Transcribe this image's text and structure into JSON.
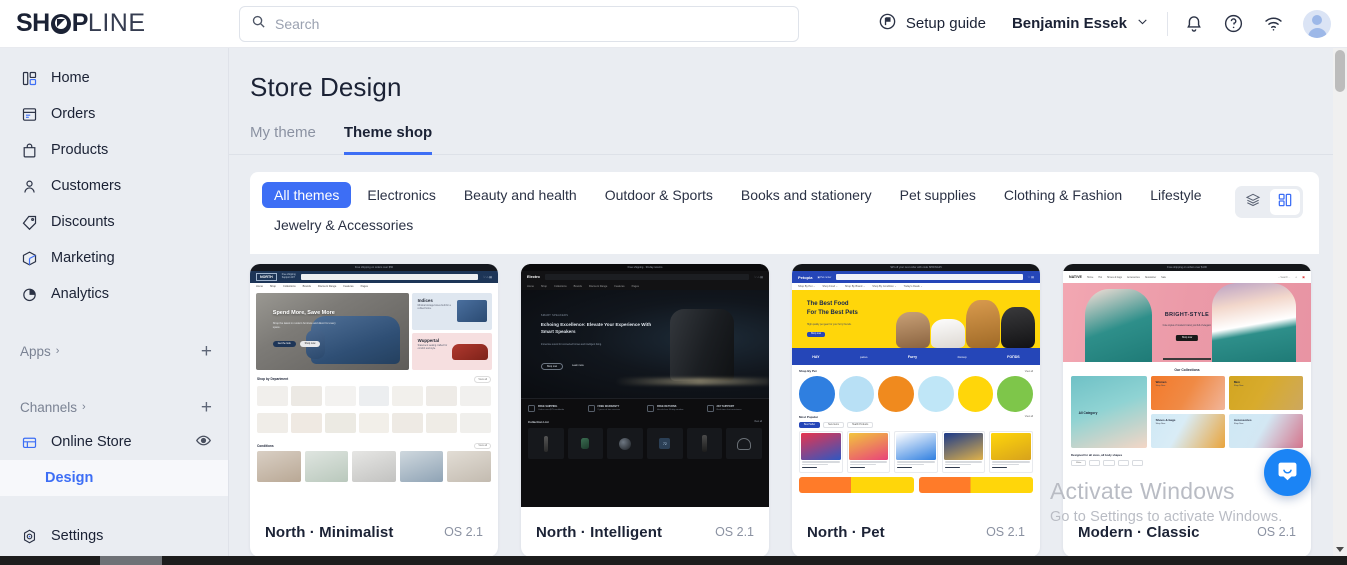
{
  "topbar": {
    "logo_bold": "SH",
    "logo_rest": "P",
    "logo_light": "LINE",
    "search_placeholder": "Search",
    "search_value": "",
    "setup_guide_label": "Setup guide",
    "user_name": "Benjamin Essek",
    "icons": {
      "search": "search-icon",
      "flag": "flag-icon",
      "chevron": "chevron-down-icon",
      "bell": "bell-icon",
      "help": "help-circle-icon",
      "wifi": "wifi-icon",
      "avatar": "avatar-icon"
    }
  },
  "sidebar": {
    "items": [
      {
        "label": "Home",
        "icon": "home-dashboard-icon"
      },
      {
        "label": "Orders",
        "icon": "orders-icon"
      },
      {
        "label": "Products",
        "icon": "products-bag-icon"
      },
      {
        "label": "Customers",
        "icon": "customers-person-icon"
      },
      {
        "label": "Discounts",
        "icon": "discounts-tag-icon"
      },
      {
        "label": "Marketing",
        "icon": "marketing-cube-icon"
      },
      {
        "label": "Analytics",
        "icon": "analytics-pie-icon"
      }
    ],
    "apps_label": "Apps",
    "channels_label": "Channels",
    "online_store_label": "Online Store",
    "design_label": "Design",
    "settings_label": "Settings",
    "add_symbol": "+",
    "chevron_symbol": "›"
  },
  "main": {
    "page_title": "Store Design",
    "tabs": [
      {
        "label": "My theme",
        "active": false
      },
      {
        "label": "Theme shop",
        "active": true
      }
    ],
    "filters": [
      {
        "label": "All themes",
        "active": true
      },
      {
        "label": "Electronics",
        "active": false
      },
      {
        "label": "Beauty and health",
        "active": false
      },
      {
        "label": "Outdoor & Sports",
        "active": false
      },
      {
        "label": "Books and stationery",
        "active": false
      },
      {
        "label": "Pet supplies",
        "active": false
      },
      {
        "label": "Clothing & Fashion",
        "active": false
      },
      {
        "label": "Lifestyle",
        "active": false
      },
      {
        "label": "Jewelry & Accessories",
        "active": false
      }
    ],
    "view_toggle": [
      {
        "name": "list-view-button",
        "icon": "layers-icon",
        "active": false
      },
      {
        "name": "grid-view-button",
        "icon": "grid-icon",
        "active": true
      }
    ],
    "themes": [
      {
        "name": "North · Minimalist",
        "version": "OS 2.1"
      },
      {
        "name": "North · Intelligent",
        "version": "OS 2.1"
      },
      {
        "name": "North · Pet",
        "version": "OS 2.1"
      },
      {
        "name": "Modern · Classic",
        "version": "OS 2.1"
      }
    ]
  },
  "previews": {
    "minimalist": {
      "topbar_note": "Free shipping on orders over $50",
      "brand": "NORTH",
      "search_placeholder": "Search...",
      "nav": [
        "Home",
        "Shop",
        "Collections",
        "Brands",
        "Discount Range",
        "Features",
        "Pages"
      ],
      "hero_title": "Spend More, Save More",
      "hero_sub": "Shop the latest in modern furniture and décor for every space.",
      "hero_btn_primary": "Get the look",
      "hero_btn_secondary": "Shop now",
      "promo1_title": "Indices",
      "promo1_sub": "Minimal storage boxes built for a refined home.",
      "promo2_title": "Wuppertal",
      "promo2_sub": "Statement seating crafted for comfort and style.",
      "section1_title": "Shop by Department",
      "section1_link": "View all",
      "section2_title": "Conditions",
      "section2_link": "View all"
    },
    "intelligent": {
      "topbar_note": "Free shipping · 30-day returns",
      "brand": "Electro",
      "nav": [
        "Home",
        "Shop",
        "Collections",
        "Brands",
        "Discount Range",
        "Features",
        "Pages"
      ],
      "eyebrow": "SMART SPEAKERS",
      "hero_title": "Echoing Excellence: Elevate Your Experience With Smart Speakers",
      "hero_sub": "Immersive sound for connected homes and intelligent living.",
      "hero_btn_primary": "Shop now",
      "hero_btn_secondary": "Learn more",
      "features": [
        {
          "title": "FREE SHIPPING",
          "sub": "Orders over $75 worldwide"
        },
        {
          "title": "FREE WARRANTY",
          "sub": "2 years of free services"
        },
        {
          "title": "FREE RETURNS",
          "sub": "Hassle-free 30-day window"
        },
        {
          "title": "24/7 SUPPORT",
          "sub": "Real-time chat assistance"
        }
      ],
      "section_title": "Collection List",
      "section_link": "View all",
      "thermostat_value": "72"
    },
    "pet": {
      "topbar_note": "$25 off your next order with code SPRING25",
      "brand": "Petopia",
      "search_placeholder": "Search...",
      "nav": [
        "Shop By Pet",
        "Shop Food",
        "Shop By Brand",
        "Shop By Condition",
        "Today's Deals"
      ],
      "hero_title_line1": "The Best Food",
      "hero_title_line2": "For The Best Pets",
      "hero_sub": "High quality pet gear for your furry friends.",
      "hero_btn": "Shop now",
      "brands": [
        "HAY",
        "petso",
        "Furry",
        "iGroup",
        "FOПDS"
      ],
      "section1_title": "Shop By Pet",
      "section1_link": "View all",
      "section2_title": "Most Popular",
      "section2_link": "View all",
      "tabs": [
        "Best Seller",
        "New Items",
        "Health Products"
      ]
    },
    "classic": {
      "topbar_note": "Free shipping on orders over $100",
      "brand": "NAT/VE",
      "nav": [
        "Home",
        "Hot",
        "Shoes & bags",
        "Accessories",
        "Newsletter",
        "Sale"
      ],
      "search_placeholder": "Search...",
      "hero_title": "BRIGHT-STYLE",
      "hero_sub": "Cute styles of modern brand, just full of elegant.",
      "hero_btn": "Shop now",
      "section_title": "Our Collections",
      "collections": [
        {
          "title": "All Category",
          "sub": ""
        },
        {
          "title": "Women",
          "sub": "Shop Now"
        },
        {
          "title": "Men",
          "sub": "Shop Now"
        },
        {
          "title": "Shoes & bags",
          "sub": "Shop Now"
        },
        {
          "title": "Accessories",
          "sub": "Shop Now"
        }
      ],
      "footer_title": "Designed for all sizes, all body shapes",
      "footer_chips": [
        "White",
        "",
        "",
        "",
        ""
      ]
    }
  },
  "watermark": {
    "line1": "Activate Windows",
    "line2": "Go to Settings to activate Windows."
  },
  "chat": {
    "icon": "chat-bubble-icon"
  },
  "colors": {
    "accent": "#3d6ef5",
    "sidebar_bg": "#eaedf2",
    "text": "#1b2235",
    "muted": "#8b92a2",
    "chat_blue": "#1b84f5"
  }
}
